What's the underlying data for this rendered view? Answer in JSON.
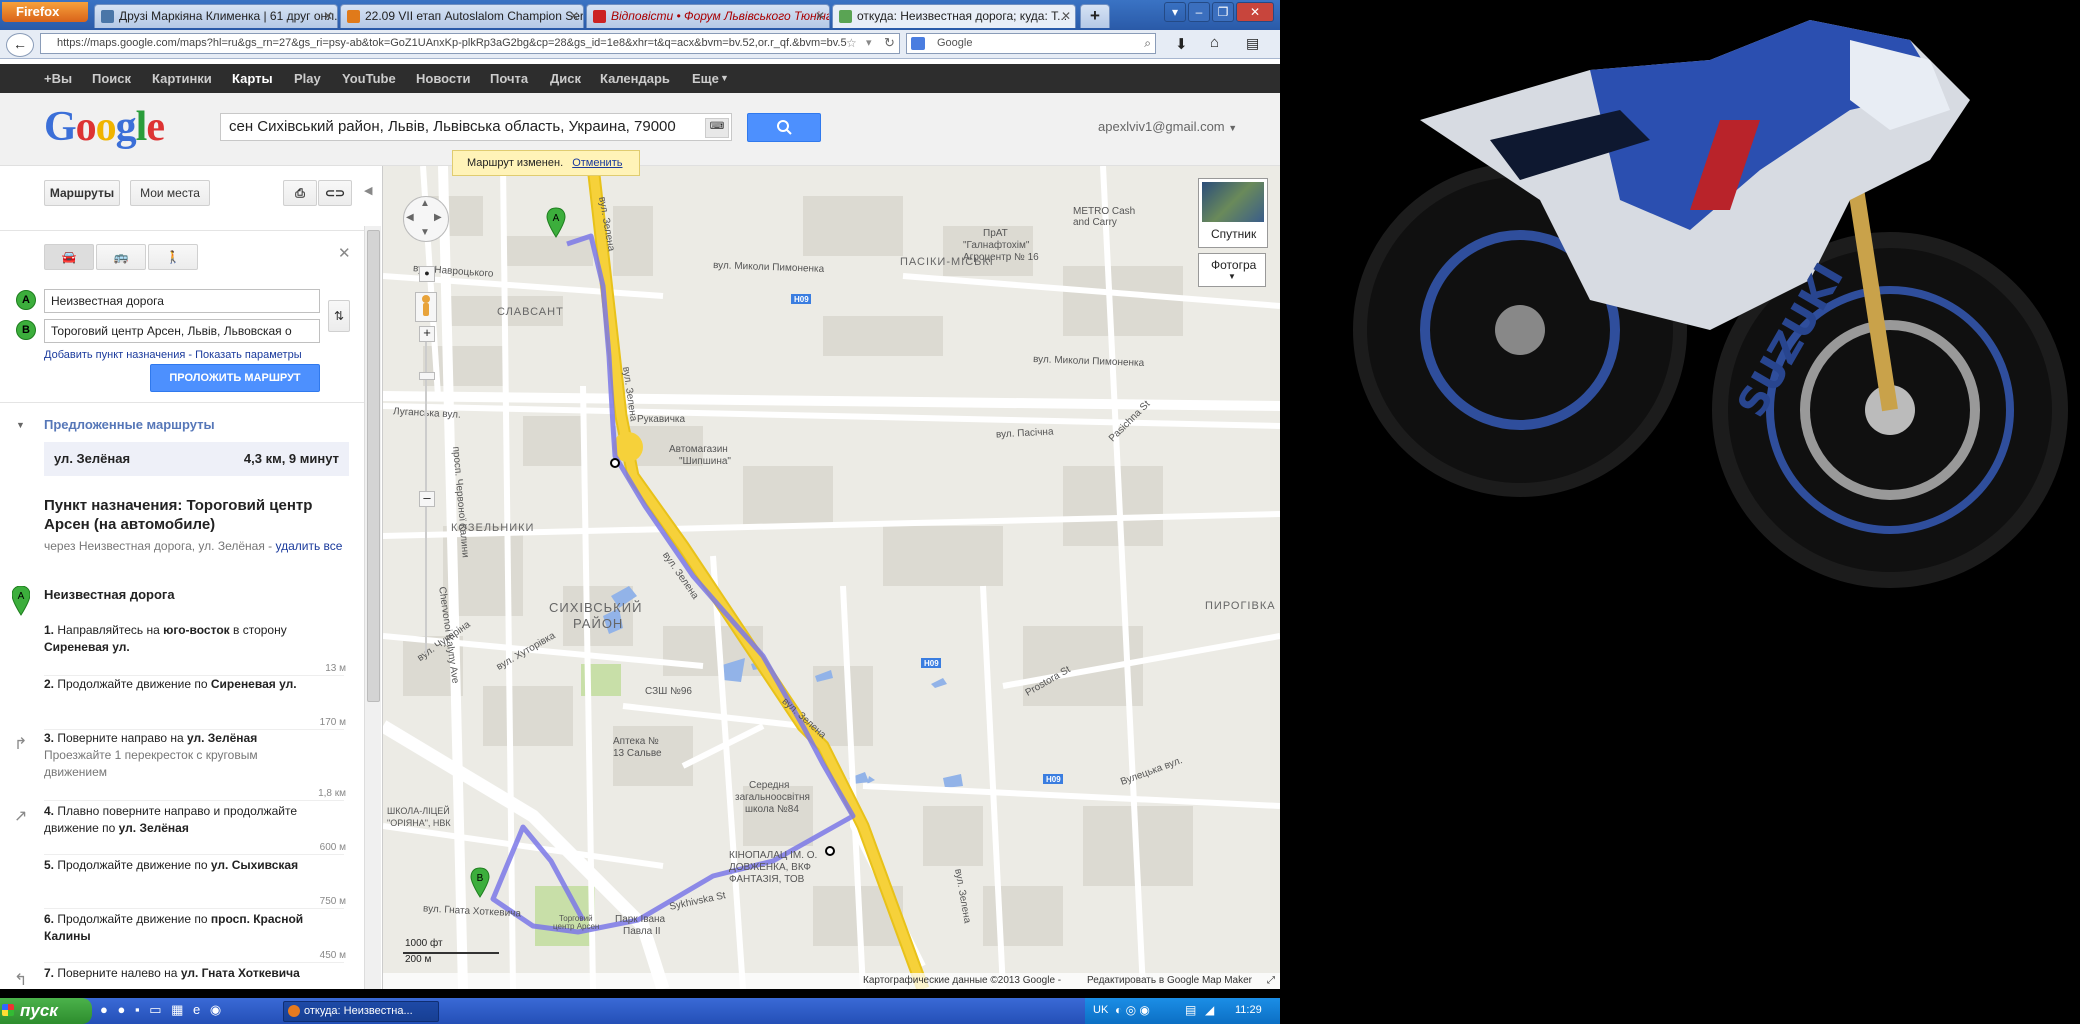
{
  "browser": {
    "menu_button": "Firefox",
    "tabs": [
      {
        "label": "Друзі Маркіяна Клименка | 61 друг онл...",
        "active": false
      },
      {
        "label": "22.09 VII етап Autoslalom Champion Seri...",
        "active": false
      },
      {
        "label": "Відповісти • Форум Львівського Тюнінг...",
        "active": false
      },
      {
        "label": "откуда: Неизвестная дорога; куда: Т...",
        "active": true
      }
    ],
    "new_tab": "+",
    "url": "https://maps.google.com/maps?hl=ru&gs_rn=27&gs_ri=psy-ab&tok=GoZ1UAnxKp-plkRp3aG2bg&cp=28&gs_id=1e8&xhr=t&q=acx&bvm=bv.52,or.r_qf.&bvm=bv.5",
    "search_engine": "Google",
    "search_placeholder": "Google"
  },
  "google_bar": {
    "items": [
      "+Вы",
      "Поиск",
      "Картинки",
      "Карты",
      "Play",
      "YouTube",
      "Новости",
      "Почта",
      "Диск",
      "Календарь",
      "Еще"
    ],
    "selected": "Карты"
  },
  "header": {
    "logo": "Google",
    "search_value": "сен Сихівський район, Львів, Львівська область, Украина, 79000",
    "account": "apexlviv1@gmail.com"
  },
  "panel": {
    "btn_routes": "Маршруты",
    "btn_myplaces": "Мои места",
    "input_a": "Неизвестная дорога",
    "input_b": "Тороговий центр Арсен, Львів, Львовская о",
    "marker_a": "A",
    "marker_b": "B",
    "add_dest": "Добавить пункт назначения",
    "separator": " - ",
    "show_options": "Показать параметры",
    "build_route": "ПРОЛОЖИТЬ МАРШРУТ",
    "suggested": "Предложенные маршруты",
    "route_name": "ул. Зелёная",
    "route_info": "4,3 км, 9 минут",
    "dest_title": "Пункт назначения: Тороговий центр Арсен (на автомобиле)",
    "via": "через Неизвестная дорога, ул. Зелёная - ",
    "delete_all": "удалить все",
    "start_label": "Неизвестная дорога",
    "steps": [
      {
        "num": "1.",
        "text": "Направляйтесь на",
        "b1": "юго-восток",
        "mid": " в сторону ",
        "b2": "Сиреневая ул.",
        "dist": "13 м"
      },
      {
        "num": "2.",
        "text": "Продолжайте движение по",
        "b1": "",
        "mid": " ",
        "b2": "Сиреневая ул.",
        "dist": "170 м"
      },
      {
        "num": "3.",
        "text": "Поверните направо на",
        "b1": "",
        "mid": " ",
        "b2": "ул. Зелёная",
        "sub": "Проезжайте 1 перекресток с круговым движением",
        "dist": "1,8 км"
      },
      {
        "num": "4.",
        "text": "Плавно поверните направо и продолжайте движение по",
        "b1": "",
        "mid": " ",
        "b2": "ул. Зелёная",
        "dist": "600 м"
      },
      {
        "num": "5.",
        "text": "Продолжайте движение по",
        "b1": "",
        "mid": " ",
        "b2": "ул. Сыхивская",
        "dist": "750 м"
      },
      {
        "num": "6.",
        "text": "Продолжайте движение по",
        "b1": "",
        "mid": " ",
        "b2": "просп. Красной Калины",
        "dist": "450 м"
      },
      {
        "num": "7.",
        "text": "Поверните налево на",
        "b1": "",
        "mid": " ",
        "b2": "ул. Гната Хоткевича",
        "dist": ""
      }
    ]
  },
  "map": {
    "notice_text": "Маршрут изменен.",
    "notice_undo": "Отменить",
    "satellite": "Спутник",
    "photos": "Фотогра",
    "scale_ft": "1000 фт",
    "scale_m": "200 м",
    "copyright": "Картографические данные ©2013 Google -",
    "edit_link": "Редактировать в Google Map Maker",
    "labels": {
      "zelena1": "вул. Зелена",
      "zelena2": "вул. Зелена",
      "zelena3": "вул. Зелена",
      "zelena4": "вул. Зелена",
      "zelena5": "вул. Зелена",
      "pasichna": "вул. Пасічна",
      "luhanska": "Луганська вул.",
      "pasiky": "ПАСІКИ-МІСЬКІ",
      "syhiv": "СИХІВСЬКИЙ",
      "rayon": "РАЙОН",
      "kozelnyky": "КОЗЕЛЬНИКИ",
      "pyrohivka": "ПИРОГІВКА",
      "slavsant": "СЛАВСАНТ",
      "metro": "METRO Cash",
      "metro2": "and Carry",
      "agrocenter": "ПрАТ",
      "agrocenter2": "\"Галнафтохім\"",
      "agrocenter3": "Агроцентр № 16",
      "shyn": "Автомагазин",
      "shyn2": "\"Шипшина\"",
      "rukavychka": "Рукавичка",
      "school": "Середня",
      "school2": "загальноосвітня",
      "school3": "школа №84",
      "cinema": "КІНОПАЛАЦ ІМ. О.",
      "cinema2": "ДОВЖЕНКА, ВКФ",
      "cinema3": "ФАНТАЗІЯ, ТОВ",
      "pharmacy": "Аптека №",
      "pharmacy2": "13 Сальве",
      "ssh": "СЗШ №96",
      "park": "Парк Івана",
      "park2": "Павла ІІ",
      "trade": "Торговий",
      "trade2": "центр Арсен",
      "khot": "вул. Гната Хоткевича",
      "sykhivska": "Sykhivska St",
      "chervonoi": "Chervonoi Kalyny Ave",
      "prosp": "просп. Червоної Калини",
      "pasichna_st": "Pasichna St",
      "mykoly": "вул. Миколи Пимоненка",
      "mykoly2": "вул. Миколи Пимоненка",
      "khutor": "вул. Хуторівка",
      "chukarina": "вул. Чукаріна",
      "h09": "H09",
      "vulets": "Вулецька вул.",
      "prostora": "Prostora St",
      "navrotsk": "вул. Навроцького",
      "schoollyc": "ШКОЛА-ЛІЦЕЙ",
      "schoollyc2": "\"ОРІЯНА\", НВК"
    }
  },
  "taskbar": {
    "start": "пуск",
    "task_item": "откуда: Неизвестна...",
    "lang": "UK",
    "clock": "11:29"
  },
  "colors": {
    "route": "#7b78e8",
    "road_major": "#f6d13a",
    "map_bg": "#ecebe5",
    "accent_blue": "#4d90fe"
  }
}
